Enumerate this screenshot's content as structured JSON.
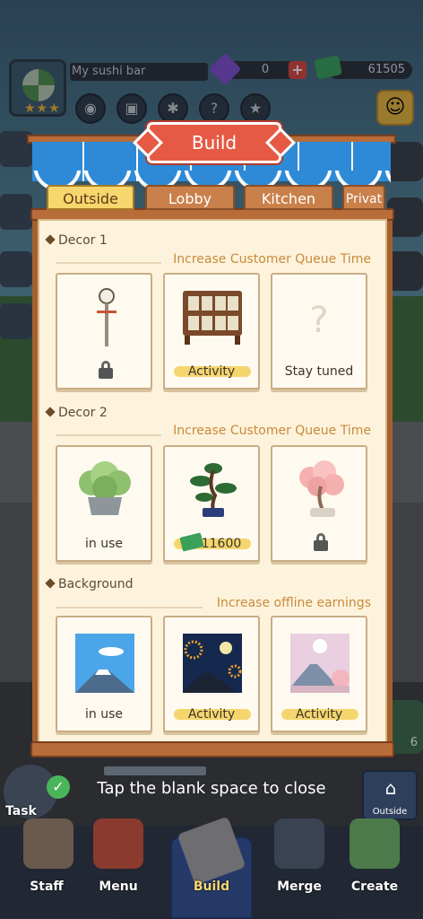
{
  "hud": {
    "bar_name": "My sushi bar",
    "gems": "0",
    "cash": "61505",
    "stars": "★★★"
  },
  "panel": {
    "title": "Build",
    "tabs": [
      "Outside",
      "Lobby",
      "Kitchen",
      "Privat"
    ],
    "active_tab": "Outside",
    "sections": [
      {
        "title": "Decor 1",
        "subtitle": "Increase Customer Queue Time",
        "cards": [
          {
            "icon": "lamp-post-icon",
            "label": "",
            "status": "locked"
          },
          {
            "icon": "shelf-display-icon",
            "label": "Activity",
            "status": "activity"
          },
          {
            "icon": "question-icon",
            "label": "Stay tuned",
            "status": "coming"
          }
        ]
      },
      {
        "title": "Decor 2",
        "subtitle": "Increase Customer Queue Time",
        "cards": [
          {
            "icon": "shrub-pot-icon",
            "label": "in use",
            "status": "in-use"
          },
          {
            "icon": "bonsai-icon",
            "label": "11600",
            "status": "price"
          },
          {
            "icon": "cherry-tree-icon",
            "label": "",
            "status": "locked"
          }
        ]
      },
      {
        "title": "Background",
        "subtitle": "Increase offline earnings",
        "cards": [
          {
            "icon": "mount-fuji-icon",
            "label": "in use",
            "status": "in-use"
          },
          {
            "icon": "fireworks-icon",
            "label": "Activity",
            "status": "activity"
          },
          {
            "icon": "fuji-sakura-icon",
            "label": "Activity",
            "status": "activity"
          }
        ]
      }
    ]
  },
  "close_hint": "Tap the blank space to close",
  "task_label": "Task",
  "outside_label": "Outside",
  "side_count": "6",
  "nav": [
    "Staff",
    "Menu",
    "Build",
    "Merge",
    "Create"
  ],
  "colors": {
    "panel_wood": "#a5602f",
    "panel_bg": "#fdf3dc",
    "awning_blue": "#2e8ad6",
    "banner_red": "#e65a45",
    "tab_active": "#f6d66d",
    "subtitle": "#c98a3c"
  }
}
